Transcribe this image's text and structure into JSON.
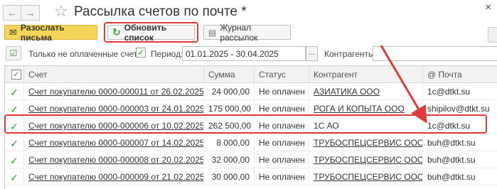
{
  "window": {
    "title": "Рассылка счетов по почте *",
    "close_glyph": "×"
  },
  "toolbar": {
    "send_label": "Разослать письма",
    "refresh_label": "Обновить список",
    "log_label": "Журнал рассылок"
  },
  "filter": {
    "only_unpaid_label": "Только не оплаченные счета:",
    "only_unpaid_checked": true,
    "period_label": "Период:",
    "period_value": "01.01.2025 - 30.04.2025",
    "period_button": "...",
    "contractors_label": "Контрагенты:",
    "contractors_value": ""
  },
  "table": {
    "headers": {
      "invoice": "Счет",
      "amount": "Сумма",
      "status": "Статус",
      "contractor": "Контрагент",
      "email": "@ Почта"
    },
    "rows": [
      {
        "checked": true,
        "invoice": "Счет покупателю 0000-000011 от 26.02.2025...",
        "amount": "24 000,00",
        "status": "Не оплачен",
        "contractor": "АЗИАТИКА ООО",
        "contractor_link": true,
        "email": "1c@dtkt.su"
      },
      {
        "checked": true,
        "invoice": "Счет покупателю 0000-000003 от 24.01.2025...",
        "amount": "175 000,00",
        "status": "Не оплачен",
        "contractor": "РОГА И КОПЫТА ООО",
        "contractor_link": true,
        "email": "shipilov@dtkt.su"
      },
      {
        "checked": true,
        "invoice": "Счет покупателю 0000-000006 от 10.02.2025...",
        "amount": "262 500,00",
        "status": "Не оплачен",
        "contractor": "1С АО",
        "contractor_link": false,
        "email": "1c@dtkt.su"
      },
      {
        "checked": true,
        "invoice": "Счет покупателю 0000-000007 от 14.02.2025...",
        "amount": "8 000,00",
        "status": "Не оплачен",
        "contractor": "ТРУБОСПЕЦСЕРВИС ООО",
        "contractor_link": true,
        "email": "buh@dtkt.su"
      },
      {
        "checked": true,
        "invoice": "Счет покупателю 0000-000008 от 20.02.2025...",
        "amount": "32 000,00",
        "status": "Не оплачен",
        "contractor": "ТРУБОСПЕЦСЕРВИС ООО",
        "contractor_link": true,
        "email": "buh@dtkt.su"
      },
      {
        "checked": true,
        "invoice": "Счет покупателю 0000-000009 от 21.02.2025...",
        "amount": "30 000,00",
        "status": "Не оплачен",
        "contractor": "ТРУБОСПЕЦСЕРВИС ООО",
        "contractor_link": true,
        "email": "buh@dtkt.su"
      }
    ]
  },
  "colors": {
    "accent_yellow": "#f5d45a",
    "highlight_red": "#e03a3a",
    "check_green": "#2e9a2e"
  },
  "icons": [
    "back-arrow-icon",
    "forward-arrow-icon",
    "star-icon",
    "envelope-icon",
    "refresh-icon",
    "journal-icon",
    "checkbox-icon",
    "email-at-icon"
  ]
}
